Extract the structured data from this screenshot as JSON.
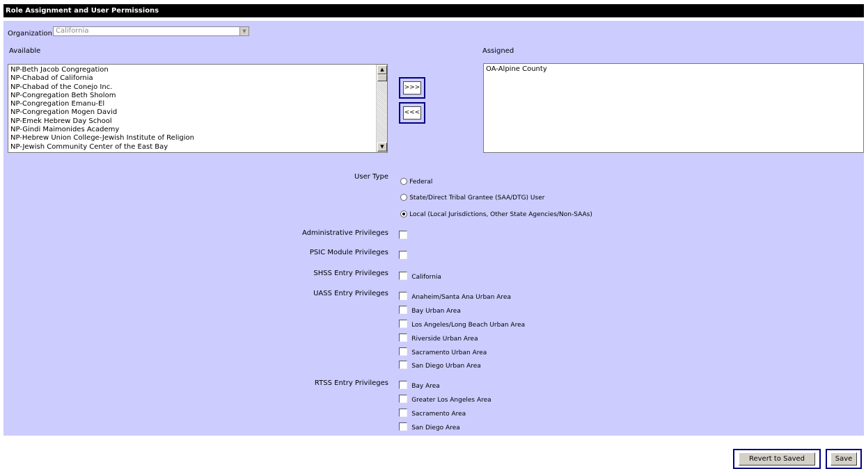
{
  "header": {
    "title": "Role Assignment and User Permissions"
  },
  "organization": {
    "label": "Organization",
    "selected": "California"
  },
  "available": {
    "label": "Available",
    "items": [
      "NP-Beth Jacob Congregation",
      "NP-Chabad of California",
      "NP-Chabad of the Conejo Inc.",
      "NP-Congregation Beth Sholom",
      "NP-Congregation Emanu-El",
      "NP-Congregation Mogen David",
      "NP-Emek Hebrew Day School",
      "NP-Gindi Maimonides Academy",
      "NP-Hebrew Union College-Jewish Institute of Religion",
      "NP-Jewish Community Center of the East Bay"
    ]
  },
  "assigned": {
    "label": "Assigned",
    "items": [
      "OA-Alpine County"
    ]
  },
  "move_buttons": {
    "add": ">>>",
    "remove": "<<<"
  },
  "user_type": {
    "label": "User Type",
    "options": [
      {
        "label": "Federal",
        "checked": false
      },
      {
        "label": "State/Direct Tribal Grantee (SAA/DTG) User",
        "checked": false
      },
      {
        "label": "Local (Local Jurisdictions, Other State Agencies/Non-SAAs)",
        "checked": true
      }
    ]
  },
  "admin_privileges": {
    "label": "Administrative Privileges",
    "checked": false
  },
  "psic_privileges": {
    "label": "PSIC Module Privileges",
    "checked": false
  },
  "shss_privileges": {
    "label": "SHSS Entry Privileges",
    "options": [
      "California"
    ]
  },
  "uass_privileges": {
    "label": "UASS Entry Privileges",
    "options": [
      "Anaheim/Santa Ana Urban Area",
      "Bay Urban Area",
      "Los Angeles/Long Beach Urban Area",
      "Riverside Urban Area",
      "Sacramento Urban Area",
      "San Diego Urban Area"
    ]
  },
  "rtss_privileges": {
    "label": "RTSS Entry Privileges",
    "options": [
      "Bay Area",
      "Greater Los Angeles Area",
      "Sacramento Area",
      "San Diego Area"
    ]
  },
  "footer": {
    "revert_label": "Revert to Saved",
    "save_label": "Save"
  }
}
